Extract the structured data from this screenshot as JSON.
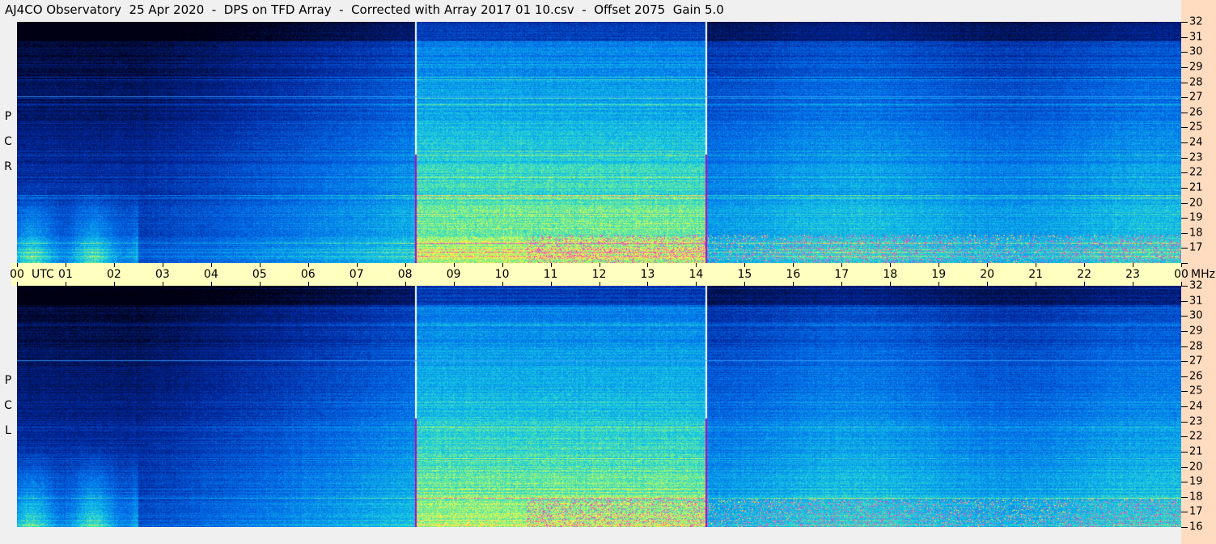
{
  "title": "AJ4CO Observatory  25 Apr 2020  -  DPS on TFD Array  -  Corrected with Array 2017 01 10.csv  -  Offset 2075  Gain 5.0",
  "chart_data": {
    "type": "heatmap",
    "title": "AJ4CO Observatory  25 Apr 2020  -  DPS on TFD Array  -  Corrected with Array 2017 01 10.csv  -  Offset 2075  Gain 5.0",
    "xlabel": "UTC",
    "ylabel": "MHz",
    "x_ticks": [
      "00",
      "01",
      "02",
      "03",
      "04",
      "05",
      "06",
      "07",
      "08",
      "09",
      "10",
      "11",
      "12",
      "13",
      "14",
      "15",
      "16",
      "17",
      "18",
      "19",
      "20",
      "21",
      "22",
      "23",
      "00"
    ],
    "xlim_hours": [
      0,
      24
    ],
    "y_ticks": [
      "32",
      "31",
      "30",
      "29",
      "28",
      "27",
      "26",
      "25",
      "24",
      "23",
      "22",
      "21",
      "20",
      "19",
      "18",
      "17",
      "16"
    ],
    "ylim_mhz": [
      16,
      32
    ],
    "panels": [
      {
        "name": "RCP",
        "letters": [
          "R",
          "C",
          "P"
        ]
      },
      {
        "name": "LCP",
        "letters": [
          "L",
          "C",
          "P"
        ]
      }
    ],
    "marker_hours": [
      8.2,
      14.2
    ],
    "colors": {
      "low": "#000010",
      "mid": "#0050e0",
      "high": "#20e0e0",
      "peak": "#ffff40"
    }
  }
}
